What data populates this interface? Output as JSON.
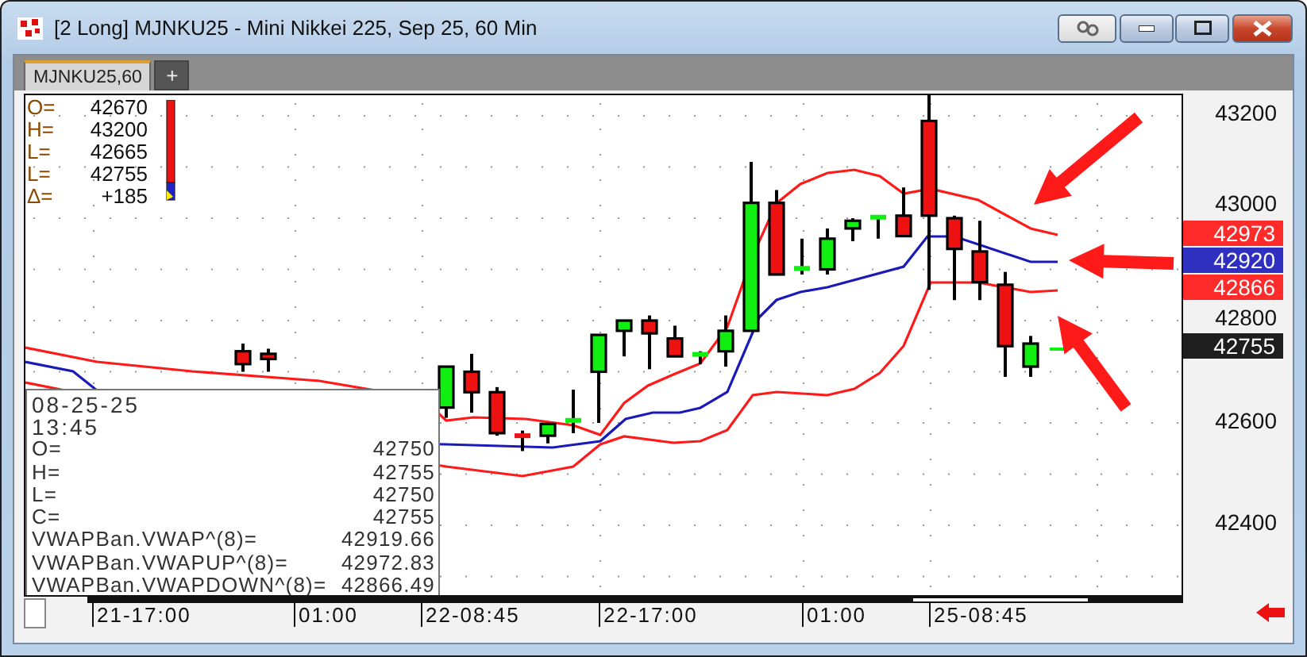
{
  "window": {
    "title": "[2 Long]  MJNKU25 - Mini Nikkei 225, Sep 25, 60 Min"
  },
  "tabs": [
    {
      "label": "MJNKU25,60",
      "selected": true
    }
  ],
  "new_tab_button": "+",
  "quote_panel": {
    "rows": [
      {
        "label": "O=",
        "value": "42670"
      },
      {
        "label": "H=",
        "value": "43200"
      },
      {
        "label": "L=",
        "value": "42665"
      },
      {
        "label": "L=",
        "value": "42755"
      },
      {
        "label": "Δ=",
        "value": "+185"
      }
    ]
  },
  "price_axis": {
    "labels": [
      "43200",
      "43000",
      "42800",
      "42600",
      "42400"
    ],
    "tags": [
      {
        "value": "42973",
        "color": "#ff2a2a"
      },
      {
        "value": "42920",
        "color": "#3030c0"
      },
      {
        "value": "42866",
        "color": "#ff2a2a"
      },
      {
        "value": "42755",
        "color": "#1e1e1e"
      }
    ]
  },
  "time_axis": {
    "labels": [
      "21-17:00",
      "01:00",
      "22-08:45",
      "22-17:00",
      "01:00",
      "25-08:45"
    ]
  },
  "data_window": {
    "date": "08-25-25",
    "time": "13:45",
    "rows": [
      {
        "label": "O=",
        "value": "42750"
      },
      {
        "label": "H=",
        "value": "42755"
      },
      {
        "label": "L=",
        "value": "42750"
      },
      {
        "label": "C=",
        "value": "42755"
      },
      {
        "label": "VWAPBan.VWAP^(8)=",
        "value": "42919.66"
      },
      {
        "label": "VWAPBan.VWAPUP^(8)=",
        "value": "42972.83"
      },
      {
        "label": "VWAPBan.VWAPDOWN^(8)=",
        "value": "42866.49"
      }
    ]
  }
}
